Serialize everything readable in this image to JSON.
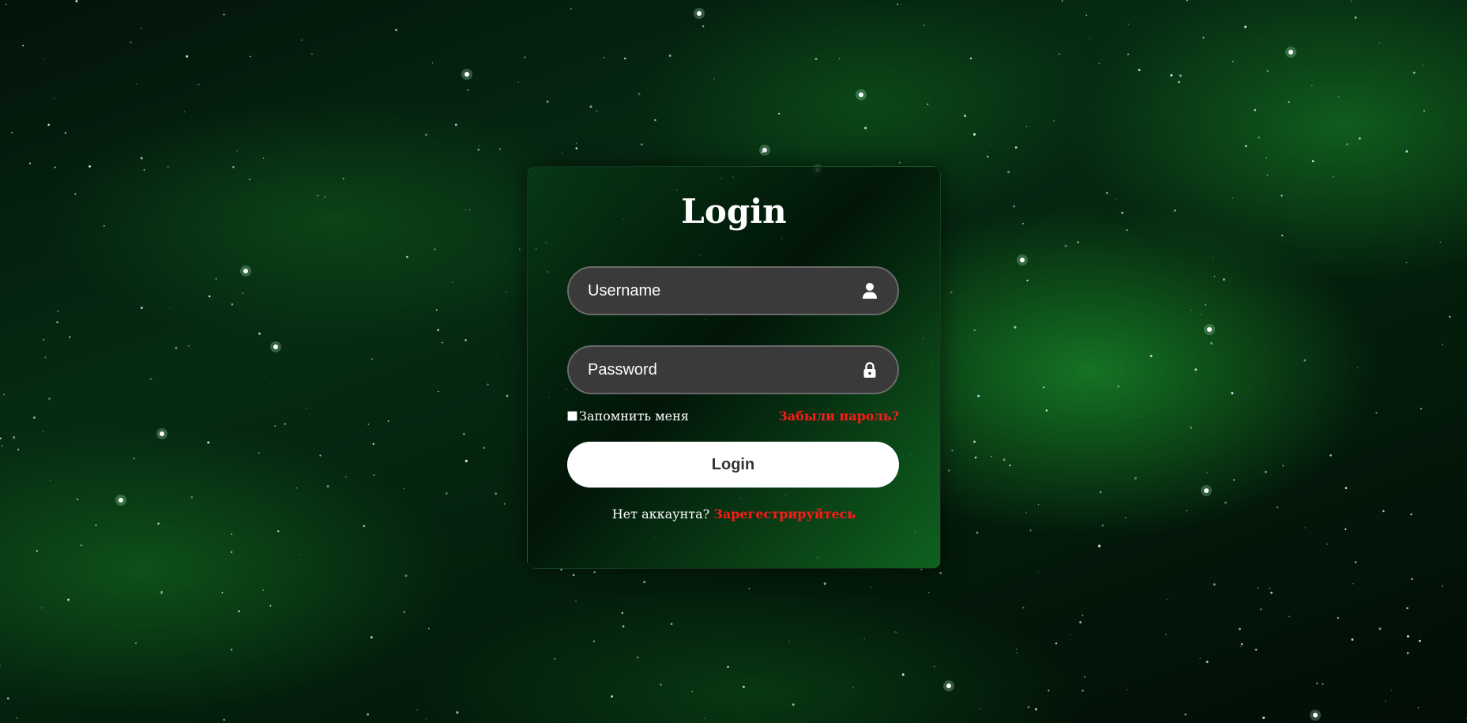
{
  "login_form": {
    "title": "Login",
    "username": {
      "placeholder": "Username",
      "value": "",
      "icon": "user-icon"
    },
    "password": {
      "placeholder": "Password",
      "value": "",
      "icon": "lock-icon"
    },
    "remember_label": "Запомнить меня",
    "remember_checked": false,
    "forgot_link": "Забыли пароль?",
    "submit_label": "Login",
    "register_prompt": "Нет аккаунта?",
    "register_link": "Зарегестрируйтесь"
  },
  "colors": {
    "accent_link": "#ff1a1a",
    "input_background": "#3a3a3a",
    "button_background": "#ffffff",
    "background_theme": "#0a5a1e"
  }
}
